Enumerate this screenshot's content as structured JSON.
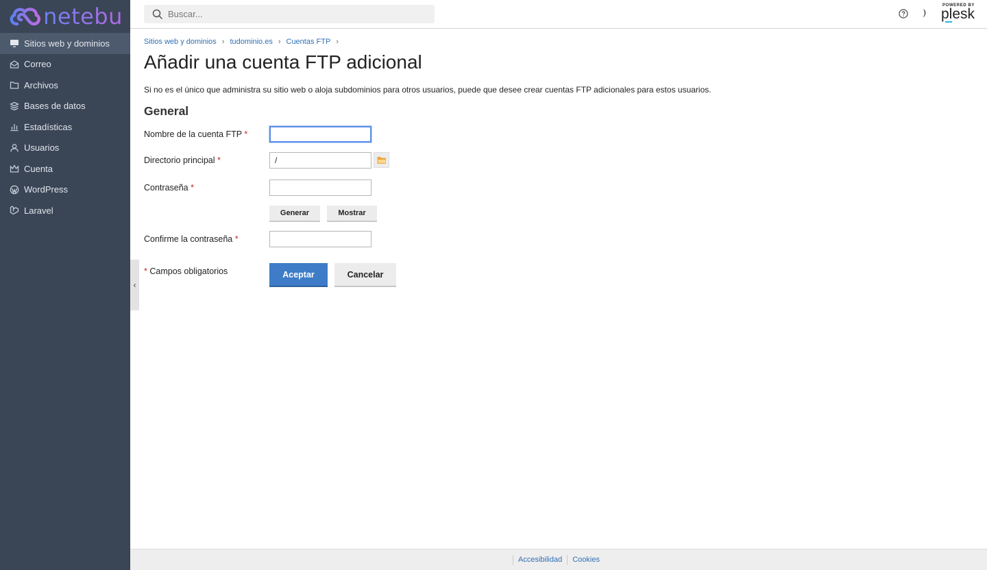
{
  "brand": {
    "name": "netebu"
  },
  "sidebar": {
    "items": [
      {
        "label": "Sitios web y dominios",
        "icon": "monitor-icon",
        "active": true
      },
      {
        "label": "Correo",
        "icon": "mail-icon"
      },
      {
        "label": "Archivos",
        "icon": "folder-icon"
      },
      {
        "label": "Bases de datos",
        "icon": "database-stack-icon"
      },
      {
        "label": "Estadísticas",
        "icon": "bar-chart-icon"
      },
      {
        "label": "Usuarios",
        "icon": "user-icon"
      },
      {
        "label": "Cuenta",
        "icon": "crown-icon"
      },
      {
        "label": "WordPress",
        "icon": "wordpress-icon"
      },
      {
        "label": "Laravel",
        "icon": "laravel-icon"
      }
    ]
  },
  "header": {
    "search_placeholder": "Buscar...",
    "powered_by": "POWERED BY",
    "plesk": "plesk"
  },
  "breadcrumb": [
    "Sitios web y dominios",
    "tudominio.es",
    "Cuentas FTP"
  ],
  "page": {
    "title": "Añadir una cuenta FTP adicional",
    "description": "Si no es el único que administra su sitio web o aloja subdominios para otros usuarios, puede que desee crear cuentas FTP adicionales para estos usuarios.",
    "section": "General"
  },
  "form": {
    "ftp_name_label": "Nombre de la cuenta FTP",
    "ftp_name_value": "",
    "home_dir_label": "Directorio principal",
    "home_dir_value": "/",
    "password_label": "Contraseña",
    "password_value": "",
    "generate_label": "Generar",
    "show_label": "Mostrar",
    "confirm_label": "Confirme la contraseña",
    "confirm_value": "",
    "required_mark": "*",
    "required_note": "Campos obligatorios",
    "accept_label": "Aceptar",
    "cancel_label": "Cancelar"
  },
  "footer": {
    "links": [
      "Accesibilidad",
      "Cookies"
    ]
  },
  "colors": {
    "sidebar_bg": "#3a4556",
    "link": "#2f6fb6",
    "primary": "#3e7cc7",
    "required": "#c12a2a"
  }
}
